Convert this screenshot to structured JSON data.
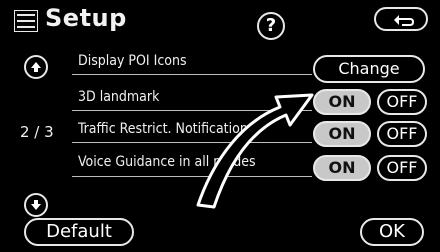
{
  "header": {
    "title": "Setup",
    "help_symbol": "?"
  },
  "rows": [
    {
      "label": "Display POI Icons",
      "button": "Change"
    },
    {
      "label": "3D landmark",
      "on": "ON",
      "off": "OFF"
    },
    {
      "label": "Traffic Restrict. Notification",
      "on": "ON",
      "off": "OFF"
    },
    {
      "label": "Voice Guidance in all modes",
      "on": "ON",
      "off": "OFF"
    }
  ],
  "pager": {
    "page": "2 / 3"
  },
  "footer": {
    "default_label": "Default",
    "ok_label": "OK"
  },
  "colors": {
    "background": "#000000",
    "on_fill": "#c8c8c8",
    "line": "#e8e8e8"
  }
}
